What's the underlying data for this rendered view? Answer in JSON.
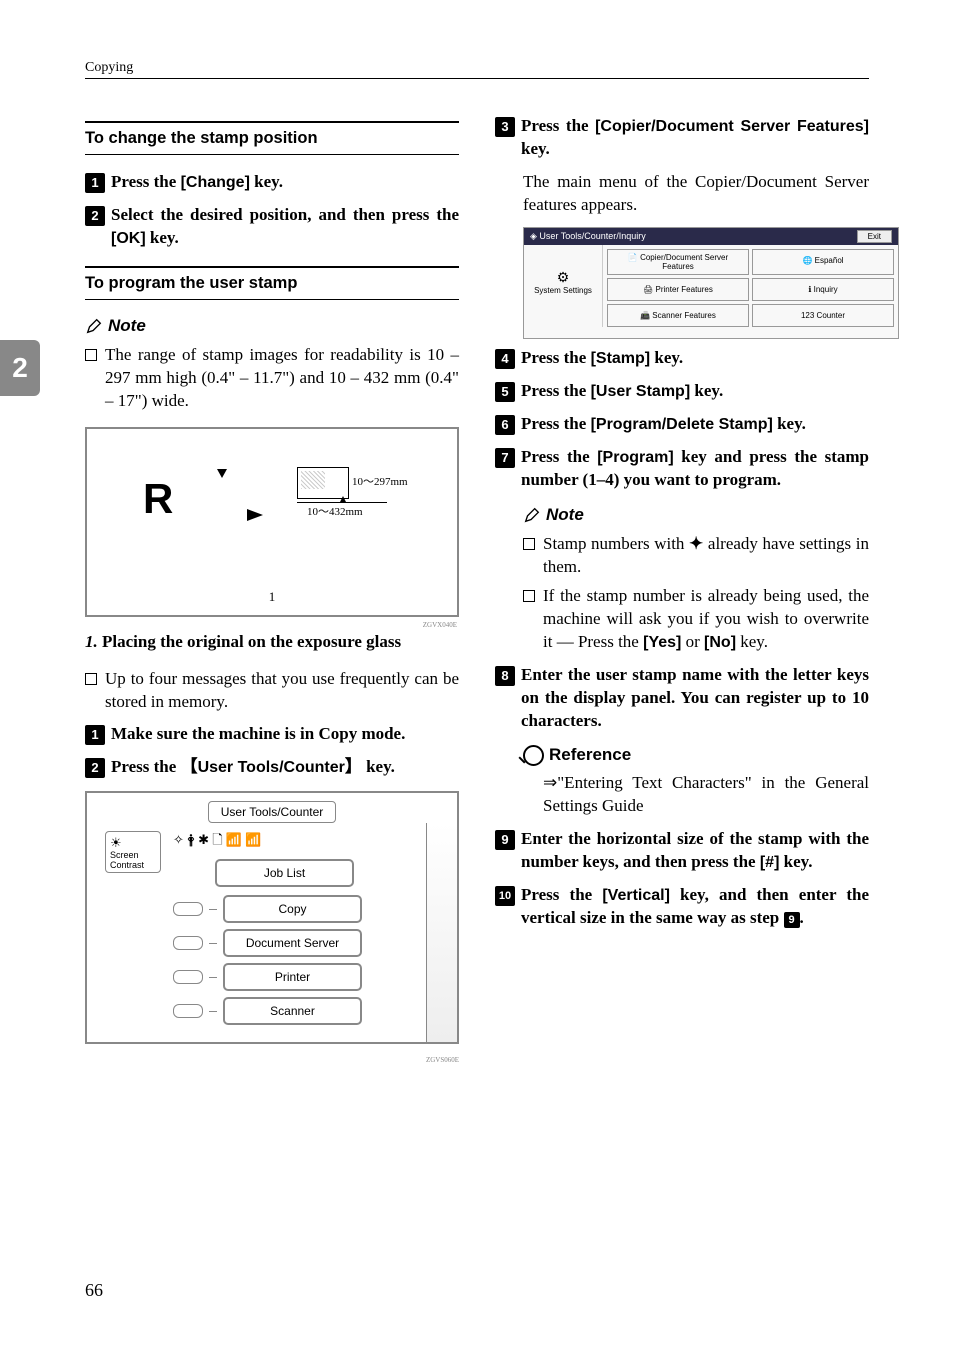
{
  "header": "Copying",
  "tab": "2",
  "page_num": "66",
  "col1": {
    "sh1": "To change the stamp position",
    "s1": {
      "n": "1",
      "pre": "Press the ",
      "k": "[Change]",
      "post": " key."
    },
    "s2": {
      "n": "2",
      "pre": "Select the desired position, and then press the ",
      "k": "[OK]",
      "post": " key."
    },
    "sh2": "To program the user stamp",
    "note": "Note",
    "nbul": "The range of stamp images for readability is 10 – 297 mm high (0.4\" – 11.7\") and 10 – 432 mm (0.4\" – 17\") wide.",
    "fig": {
      "r": "R",
      "l1": "10～297mm",
      "l2": "10～432mm",
      "cap": "1",
      "id": "ZGVX040E"
    },
    "it": "Placing the original on the exposure glass",
    "it_num": "1.",
    "bul2": "Up to four messages that you use frequently can be stored in memory.",
    "s3": {
      "n": "1",
      "t": "Make sure the machine is in Copy mode."
    },
    "s4": {
      "n": "2",
      "pre": "Press the ",
      "k": "User Tools/Counter",
      "post": " key.",
      "br": true
    },
    "panel": {
      "title": "User Tools/Counter",
      "sc": "Screen\nContrast",
      "btns": [
        "Job List",
        "Copy",
        "Document Server",
        "Printer",
        "Scanner"
      ]
    },
    "pid": "ZGVS060E"
  },
  "col2": {
    "s3": {
      "n": "3",
      "pre": "Press the ",
      "k": "[Copier/Document Server Features]",
      "post": " key."
    },
    "s3b": "The main menu of the Copier/Document Server features appears.",
    "s4": {
      "n": "4",
      "pre": "Press the ",
      "k": "[Stamp]",
      "post": " key."
    },
    "s5": {
      "n": "5",
      "pre": "Press the ",
      "k": "[User Stamp]",
      "post": " key."
    },
    "s6": {
      "n": "6",
      "pre": "Press the ",
      "k": "[Program/Delete Stamp]",
      "post": " key."
    },
    "s7": {
      "n": "7",
      "pre": "Press the ",
      "k": "[Program]",
      "post": " key and press the stamp number (1–4) you want to program."
    },
    "note": "Note",
    "nb1_pre": "Stamp numbers with ",
    "nb1_post": " already have settings in them.",
    "nb2_pre": "If the stamp number is already being used, the machine will ask you if you wish to overwrite it — Press the ",
    "nb2_k1": "[Yes]",
    "nb2_mid": " or ",
    "nb2_k2": "[No]",
    "nb2_post": " key.",
    "s8": {
      "n": "8",
      "t": "Enter the user stamp name with the letter keys on the display panel. You can register up to 10 characters."
    },
    "ref": "Reference",
    "reft": "⇒\"Entering Text Characters\" in the General Settings Guide",
    "s9": {
      "n": "9",
      "pre": "Enter the horizontal size of the stamp with the number keys, and then press the ",
      "k": "[#]",
      "post": " key."
    },
    "s10": {
      "n": "10",
      "pre": "Press the ",
      "k": "[Vertical]",
      "post": " key, and then enter the vertical size in the same way as step ",
      "ref": "9",
      "tail": "."
    }
  }
}
